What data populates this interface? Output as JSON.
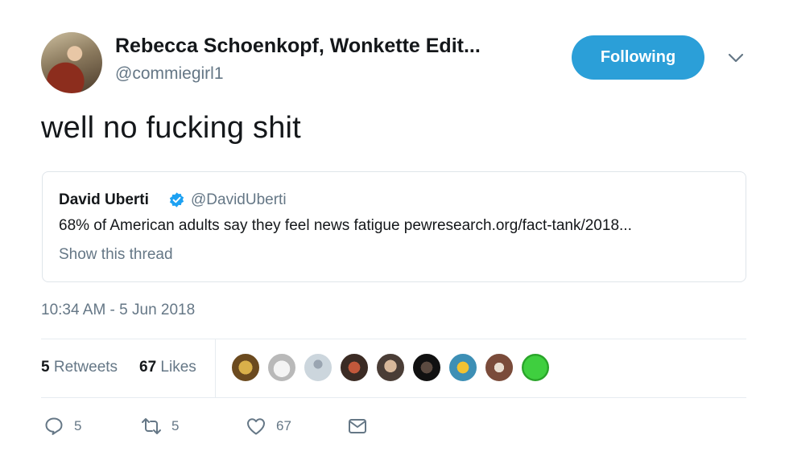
{
  "author": {
    "name": "Rebecca Schoenkopf, Wonkette Edit...",
    "handle": "@commiegirl1"
  },
  "follow_button_label": "Following",
  "tweet_text": "well no fucking shit",
  "quoted_tweet": {
    "name": "David Uberti",
    "handle": "@DavidUberti",
    "text": "68% of American adults say they feel news fatigue pewresearch.org/fact-tank/2018...",
    "thread_link": "Show this thread"
  },
  "timestamp": "10:34 AM - 5 Jun 2018",
  "stats": {
    "retweets_count": "5",
    "retweets_label": "Retweets",
    "likes_count": "67",
    "likes_label": "Likes"
  },
  "actions": {
    "reply_count": "5",
    "retweet_count": "5",
    "like_count": "67"
  },
  "colors": {
    "accent": "#2b9fd8",
    "verified": "#1da1f2",
    "muted": "#657786"
  },
  "icons": [
    "chevron-down-icon",
    "verified-badge-icon",
    "reply-icon",
    "retweet-icon",
    "heart-icon",
    "direct-message-icon"
  ]
}
